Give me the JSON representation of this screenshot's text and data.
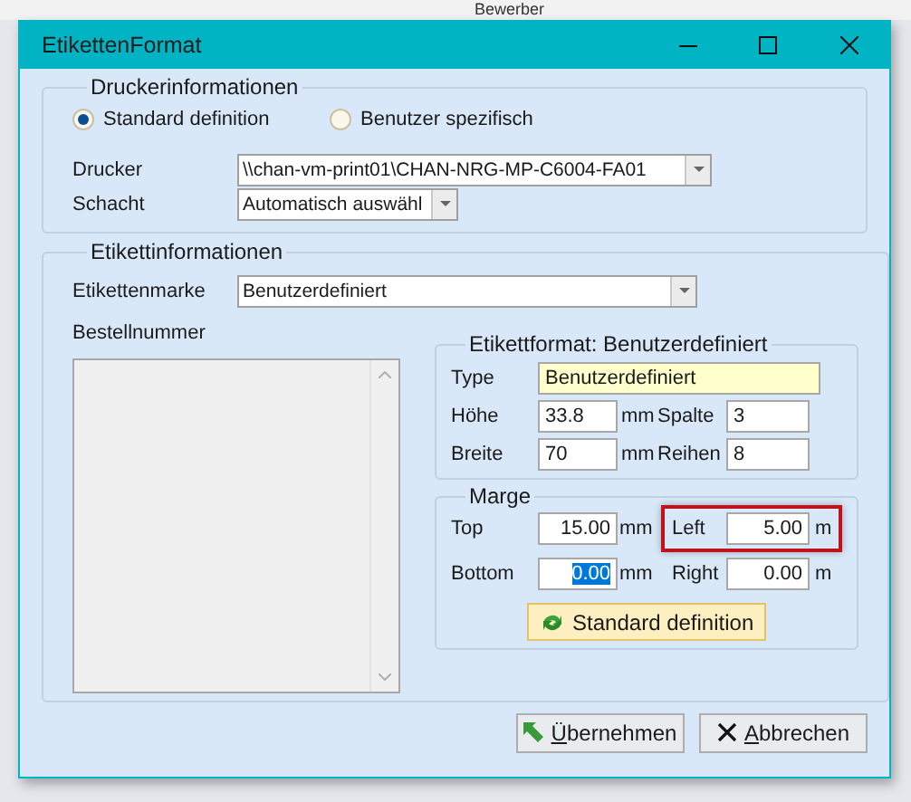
{
  "background": {
    "text": "Bewerber"
  },
  "window": {
    "title": "EtikettenFormat"
  },
  "printer_group": {
    "title": "Druckerinformationen",
    "radios": [
      {
        "label": "Standard definition",
        "selected": true
      },
      {
        "label": "Benutzer spezifisch",
        "selected": false
      }
    ],
    "fields": [
      {
        "label": "Drucker",
        "value": "\\\\chan-vm-print01\\CHAN-NRG-MP-C6004-FA01",
        "kind": "wide"
      },
      {
        "label": "Schacht",
        "value": "Automatisch auswähl",
        "kind": "narrow"
      }
    ]
  },
  "label_group": {
    "title": "Etikettinformationen",
    "brand": {
      "label": "Etikettenmarke",
      "value": "Benutzerdefiniert"
    },
    "order_number": {
      "label": "Bestellnummer"
    },
    "format": {
      "title": "Etikettformat: Benutzerdefiniert",
      "type": {
        "label": "Type",
        "value": "Benutzerdefiniert"
      },
      "rows": [
        {
          "label": "Höhe",
          "value": "33.8",
          "unit": "mm",
          "label2": "Spalte",
          "value2": "3"
        },
        {
          "label": "Breite",
          "value": "70",
          "unit": "mm",
          "label2": "Reihen",
          "value2": "8"
        }
      ]
    },
    "margins": {
      "title": "Marge",
      "rows": [
        {
          "label": "Top",
          "value": "15.00",
          "unit": "mm",
          "text_selected": false,
          "label2": "Left",
          "value2": "5.00",
          "unit2": "m",
          "highlighted": true
        },
        {
          "label": "Bottom",
          "value": "0.00",
          "unit": "mm",
          "text_selected": true,
          "label2": "Right",
          "value2": "0.00",
          "unit2": "m",
          "highlighted": false
        }
      ],
      "button": "Standard definition"
    }
  },
  "buttons": [
    {
      "label": "Übernehmen",
      "kind": "apply",
      "underline_first": true
    },
    {
      "label": "Abbrechen",
      "kind": "cancel",
      "underline_first": true
    }
  ]
}
